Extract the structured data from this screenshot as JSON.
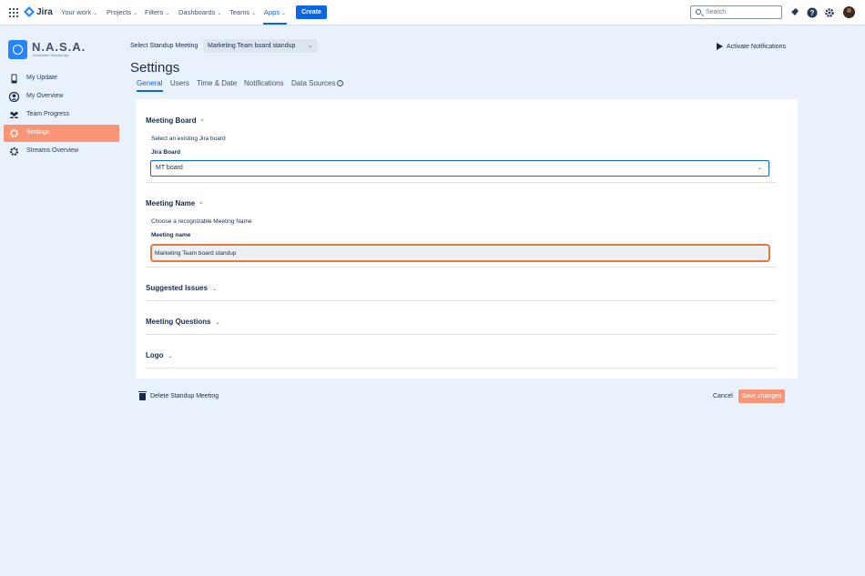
{
  "topbar": {
    "app_name": "Jira",
    "nav": [
      {
        "label": "Your work"
      },
      {
        "label": "Projects"
      },
      {
        "label": "Filters"
      },
      {
        "label": "Dashboards"
      },
      {
        "label": "Teams"
      },
      {
        "label": "Apps"
      }
    ],
    "active_nav": "Apps",
    "create_label": "Create",
    "search_placeholder": "Search"
  },
  "sidebar": {
    "brand_name": "N.A.S.A.",
    "brand_tagline": "Not Another Standup App",
    "items": [
      {
        "label": "My Update",
        "icon": "phone-icon"
      },
      {
        "label": "My Overview",
        "icon": "user-circle-icon"
      },
      {
        "label": "Team Progress",
        "icon": "team-icon"
      },
      {
        "label": "Settings",
        "icon": "gear-icon"
      },
      {
        "label": "Streams Overview",
        "icon": "gear-icon"
      }
    ],
    "active_item": "Settings"
  },
  "header": {
    "select_label": "Select Standup Meeting",
    "selected_meeting": "Marketing Team board standup",
    "activate_notifications": "Activate Notifications"
  },
  "page": {
    "title": "Settings",
    "tabs": [
      "General",
      "Users",
      "Time & Date",
      "Notifications",
      "Data Sources"
    ],
    "active_tab": "General"
  },
  "sections": {
    "meeting_board": {
      "title": "Meeting Board",
      "helper": "Select an existing Jira board",
      "field_label": "Jira Board",
      "value": "MT board"
    },
    "meeting_name": {
      "title": "Meeting Name",
      "helper": "Choose a recognizable Meeting Name",
      "field_label": "Meeting name",
      "value": "Marketing Team board standup"
    },
    "suggested_issues": {
      "title": "Suggested Issues"
    },
    "meeting_questions": {
      "title": "Meeting Questions"
    },
    "logo": {
      "title": "Logo"
    }
  },
  "actions": {
    "delete": "Delete Standup Meeting",
    "cancel": "Cancel",
    "save": "Save changes"
  },
  "colors": {
    "accent": "#0c66e4",
    "brand_orange": "#f89577",
    "focus_orange": "#e07a45",
    "page_bg": "#e9f2fc"
  }
}
